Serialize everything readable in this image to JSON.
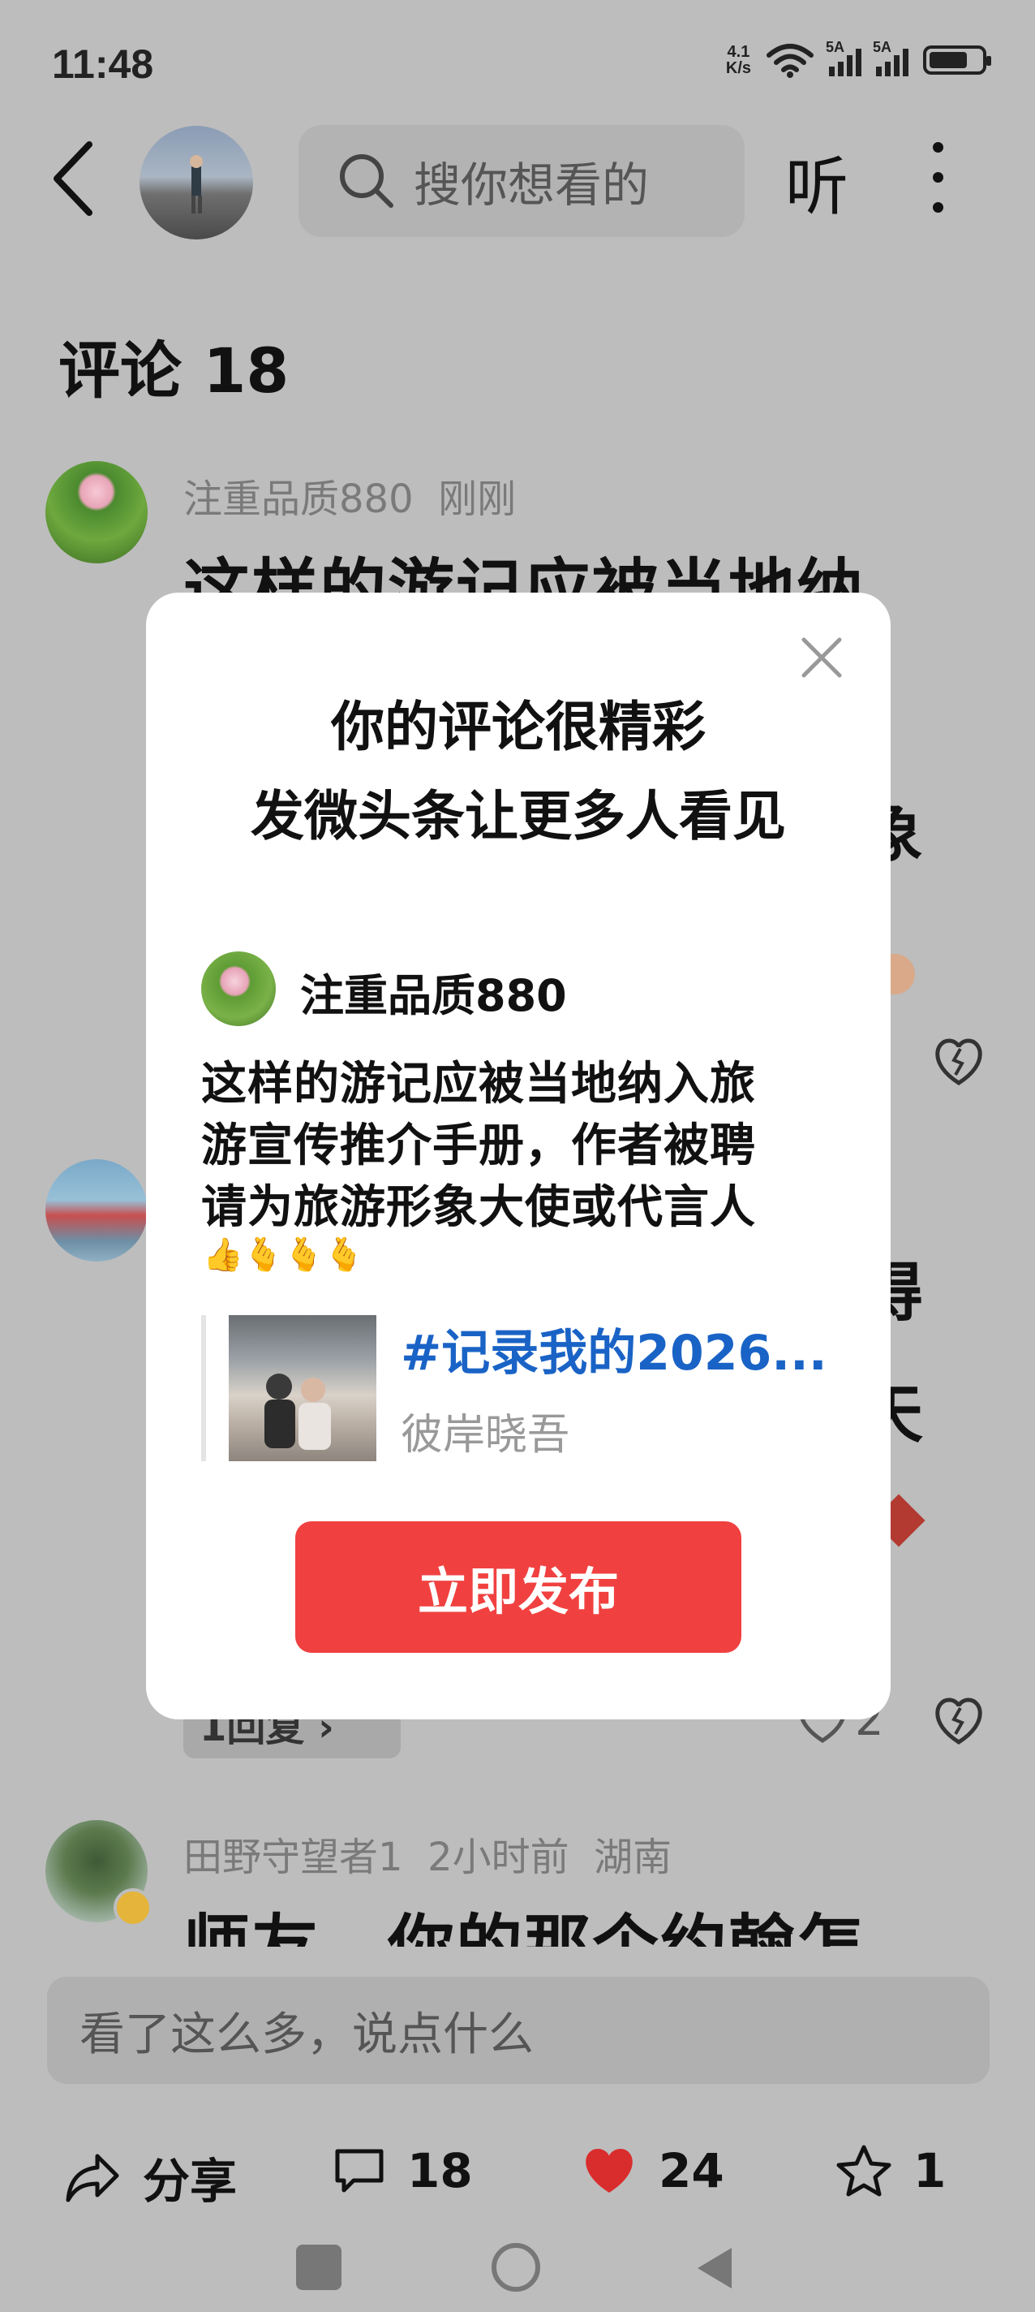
{
  "status_bar": {
    "time": "11:48",
    "net_speed_value": "4.1",
    "net_speed_unit": "K/s",
    "sim1_label": "5A",
    "sim2_label": "5A"
  },
  "header": {
    "search_placeholder": "搜你想看的",
    "listen_label": "听"
  },
  "comments": {
    "title": "评论 18",
    "items": [
      {
        "user": "注重品质880",
        "time": "刚刚",
        "text_visible": "这样的游记应被当地纳"
      },
      {
        "user": "田野守望者1",
        "time": "2小时前",
        "location": "湖南",
        "text_visible": "师友，你的那个约翰怎"
      }
    ],
    "reply_pill": "1回复 ›",
    "partial_glyphs": [
      "象",
      "得",
      "天"
    ],
    "likes_2": "2"
  },
  "comment_input": {
    "placeholder": "看了这么多，说点什么"
  },
  "bottom_bar": {
    "share_label": "分享",
    "comment_count": "18",
    "like_count": "24",
    "fav_count": "1"
  },
  "dialog": {
    "title_line1": "你的评论很精彩",
    "title_line2": "发微头条让更多人看见",
    "user": "注重品质880",
    "body_lines": [
      "这样的游记应被当地纳入旅",
      "游宣传推介手册，作者被聘",
      "请为旅游形象大使或代言人"
    ],
    "emojis": "👍🫰🫰🫰",
    "topic": "#记录我的2026...",
    "author": "彼岸晓吾",
    "publish_label": "立即发布"
  },
  "colors": {
    "background_dim": "#bdbdbd",
    "publish_button": "#f04140",
    "topic_link": "#1a63c6",
    "heart": "#d92d2d"
  }
}
